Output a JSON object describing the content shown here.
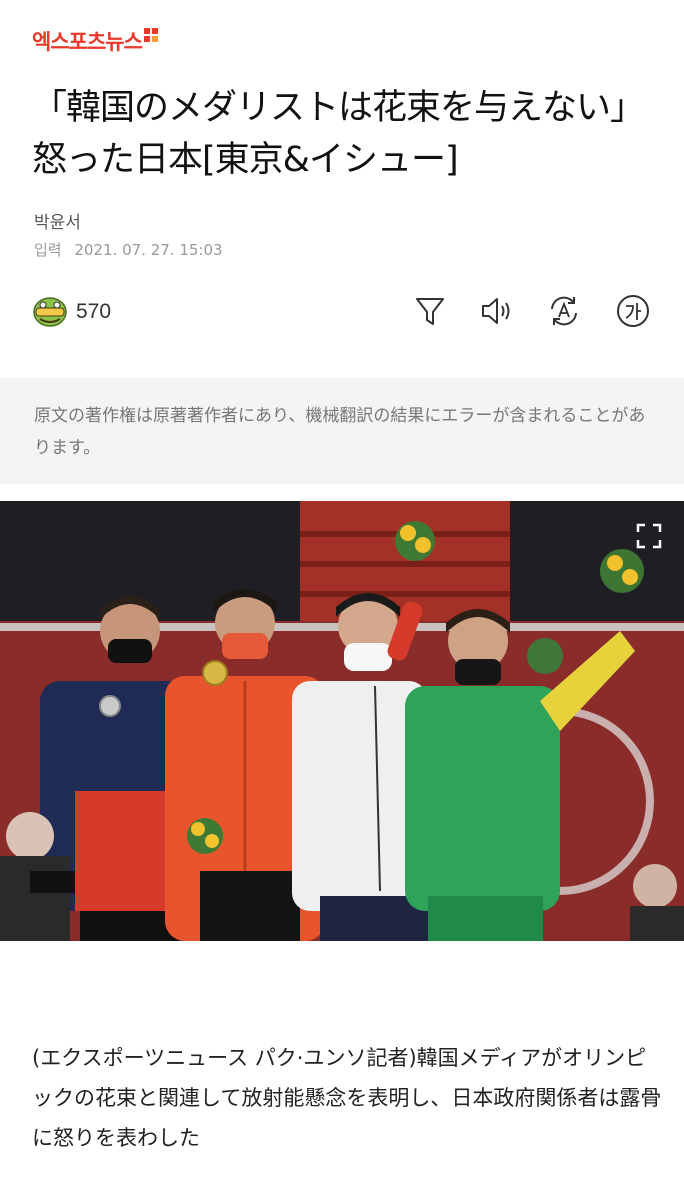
{
  "header": {
    "logo_text": "엑스포츠뉴스"
  },
  "article": {
    "title": "「韓国のメダリストは花束を与えない」怒った日本[東京&イシュー]",
    "author": "박윤서",
    "date_label": "입력",
    "date": "2021. 07. 27. 15:03"
  },
  "reactions": {
    "count": "570"
  },
  "notice": {
    "text": "原文の著作権は原著著作者にあり、機械翻訳の結果にエラーが含まれることがあります。"
  },
  "body": {
    "paragraph": "(エクスポーツニュース パク·ユンソ記者)韓国メディアがオリンピックの花束と関連して放射能懸念を表明し、日本政府関係者は露骨に怒りを表わした"
  },
  "colors": {
    "brand": "#e8392b",
    "notice_bg": "#f4f4f4",
    "japan_orange": "#e8552c",
    "brazil_green": "#2fa35a"
  },
  "icons": [
    "emoji-reaction-icon",
    "filter-icon",
    "speaker-icon",
    "translate-icon",
    "font-size-icon",
    "expand-icon"
  ]
}
